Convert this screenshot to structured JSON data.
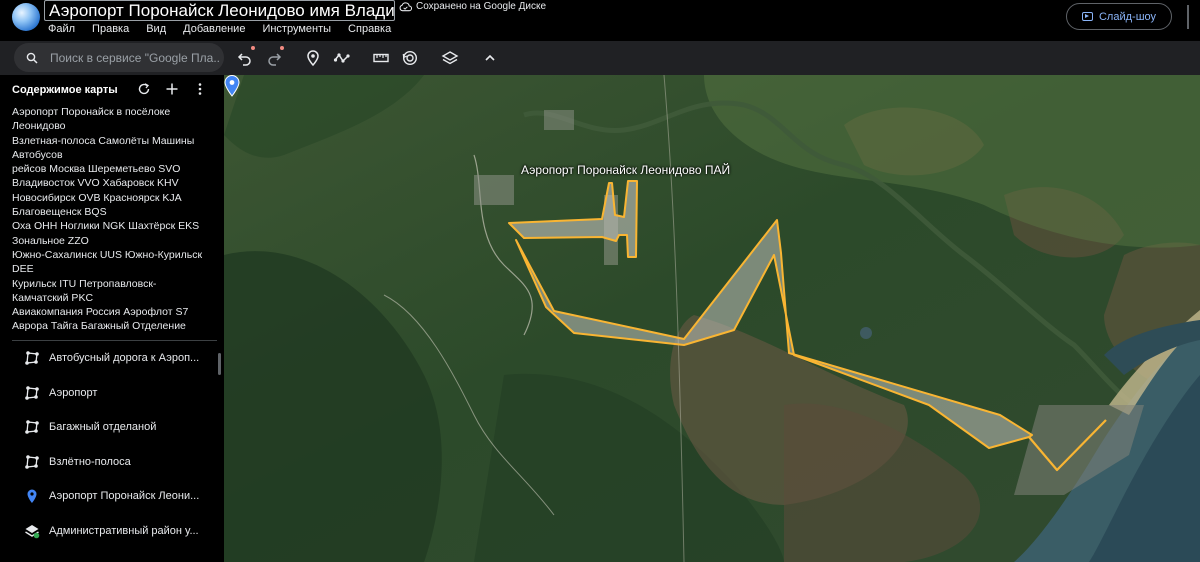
{
  "app": {
    "title": "Аэропорт Поронайск Леонидово имя Владимира",
    "saved_status": "Сохранено на Google Диске",
    "menu": [
      "Файл",
      "Правка",
      "Вид",
      "Добавление",
      "Инструменты",
      "Справка"
    ],
    "slideshow_label": "Слайд-шоу"
  },
  "toolbar": {
    "search_placeholder": "Поиск в сервисе \"Google Пла...",
    "icons": [
      "undo-icon",
      "redo-icon",
      "add-placemark-icon",
      "draw-line-icon",
      "measure-icon",
      "history-icon",
      "layers-icon",
      "chevron-up-icon"
    ]
  },
  "sidebar": {
    "title": "Содержимое карты",
    "description_lines": [
      "Аэропорт Поронайск в посёлоке",
      "Леонидово",
      "Взлетная-полоса Самолёты Машины",
      "Автобусов",
      "рейсов Москва Шереметьево SVO",
      "Владивосток VVO  Хабаровск KHV",
      "Новосибирск OVB  Красноярск KJA",
      "Благовещенск BQS",
      "Оха OHH  Ноглики NGK Шахтёрск  EKS",
      "Зональное ZZO",
      "Южно-Сахалинск UUS  Южно-Курильск",
      "DEE",
      "Курильск ITU Петропавловск-",
      "Камчатский PKC",
      "Авиакомпания Россия Аэрофлот S7",
      "Аврора Тайга Багажный Отделение"
    ],
    "layers": [
      {
        "label": "Автобусный дорога к Аэроп...",
        "icon": "polygon-icon"
      },
      {
        "label": "Аэропорт",
        "icon": "polygon-icon"
      },
      {
        "label": "Багажный отделаной",
        "icon": "polygon-icon"
      },
      {
        "label": "Взлётно-полоса",
        "icon": "polygon-icon"
      },
      {
        "label": "Аэропорт Поронайск Леони...",
        "icon": "placemark-icon"
      },
      {
        "label": "Административный район у...",
        "icon": "layers-icon"
      }
    ]
  },
  "map": {
    "label": "Аэропорт Поронайск Леонидово ПАЙ",
    "outline_color": "#f9b533"
  }
}
